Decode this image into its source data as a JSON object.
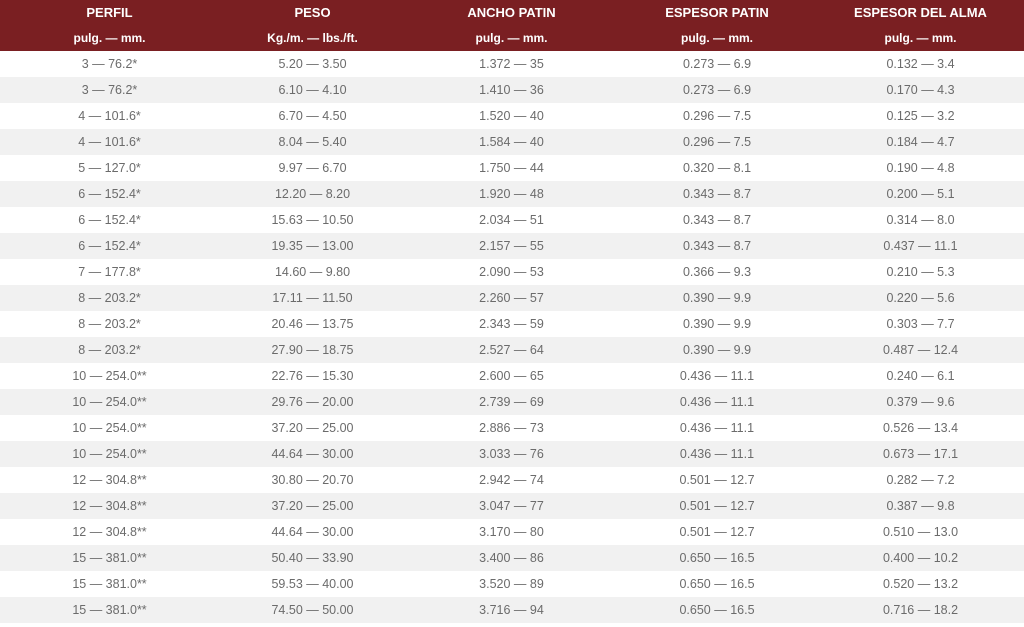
{
  "headers": [
    "PERFIL",
    "PESO",
    "ANCHO PATIN",
    "ESPESOR PATIN",
    "ESPESOR DEL ALMA"
  ],
  "units": [
    "pulg. — mm.",
    "Kg./m. — lbs./ft.",
    "pulg. — mm.",
    "pulg. — mm.",
    "pulg. — mm."
  ],
  "rows": [
    [
      "3 — 76.2*",
      "5.20 — 3.50",
      "1.372 — 35",
      "0.273 — 6.9",
      "0.132 — 3.4"
    ],
    [
      "3 — 76.2*",
      "6.10 — 4.10",
      "1.410 — 36",
      "0.273 — 6.9",
      "0.170 — 4.3"
    ],
    [
      "4 — 101.6*",
      "6.70 — 4.50",
      "1.520 — 40",
      "0.296 — 7.5",
      "0.125 — 3.2"
    ],
    [
      "4 — 101.6*",
      "8.04 — 5.40",
      "1.584 — 40",
      "0.296 — 7.5",
      "0.184 — 4.7"
    ],
    [
      "5 — 127.0*",
      "9.97 — 6.70",
      "1.750 — 44",
      "0.320 — 8.1",
      "0.190 — 4.8"
    ],
    [
      "6 — 152.4*",
      "12.20 — 8.20",
      "1.920 — 48",
      "0.343 — 8.7",
      "0.200 — 5.1"
    ],
    [
      "6 — 152.4*",
      "15.63 — 10.50",
      "2.034 — 51",
      "0.343 — 8.7",
      "0.314 — 8.0"
    ],
    [
      "6 — 152.4*",
      "19.35 — 13.00",
      "2.157 — 55",
      "0.343 — 8.7",
      "0.437 — 11.1"
    ],
    [
      "7 — 177.8*",
      "14.60 — 9.80",
      "2.090 — 53",
      "0.366 — 9.3",
      "0.210 — 5.3"
    ],
    [
      "8 — 203.2*",
      "17.11 — 11.50",
      "2.260 — 57",
      "0.390 — 9.9",
      "0.220 — 5.6"
    ],
    [
      "8 — 203.2*",
      "20.46 — 13.75",
      "2.343 — 59",
      "0.390 — 9.9",
      "0.303 — 7.7"
    ],
    [
      "8 — 203.2*",
      "27.90 — 18.75",
      "2.527 — 64",
      "0.390 — 9.9",
      "0.487 — 12.4"
    ],
    [
      "10 — 254.0**",
      "22.76 — 15.30",
      "2.600 — 65",
      "0.436 — 11.1",
      "0.240 — 6.1"
    ],
    [
      "10 — 254.0**",
      "29.76 — 20.00",
      "2.739 — 69",
      "0.436 — 11.1",
      "0.379 — 9.6"
    ],
    [
      "10 — 254.0**",
      "37.20 — 25.00",
      "2.886 — 73",
      "0.436 — 11.1",
      "0.526 — 13.4"
    ],
    [
      "10 — 254.0**",
      "44.64 — 30.00",
      "3.033 — 76",
      "0.436 — 11.1",
      "0.673 — 17.1"
    ],
    [
      "12 — 304.8**",
      "30.80 — 20.70",
      "2.942 — 74",
      "0.501 — 12.7",
      "0.282 — 7.2"
    ],
    [
      "12 — 304.8**",
      "37.20 — 25.00",
      "3.047 — 77",
      "0.501 — 12.7",
      "0.387 — 9.8"
    ],
    [
      "12 — 304.8**",
      "44.64 — 30.00",
      "3.170 — 80",
      "0.501 — 12.7",
      "0.510 — 13.0"
    ],
    [
      "15 — 381.0**",
      "50.40 — 33.90",
      "3.400 — 86",
      "0.650 — 16.5",
      "0.400 — 10.2"
    ],
    [
      "15 — 381.0**",
      "59.53 — 40.00",
      "3.520 — 89",
      "0.650 — 16.5",
      "0.520 — 13.2"
    ],
    [
      "15 — 381.0**",
      "74.50 — 50.00",
      "3.716 — 94",
      "0.650 — 16.5",
      "0.716 — 18.2"
    ]
  ],
  "colors": {
    "header_bg": "#7a1f22",
    "stripe_bg": "#f1f1f1",
    "text": "#6b6b6b"
  }
}
